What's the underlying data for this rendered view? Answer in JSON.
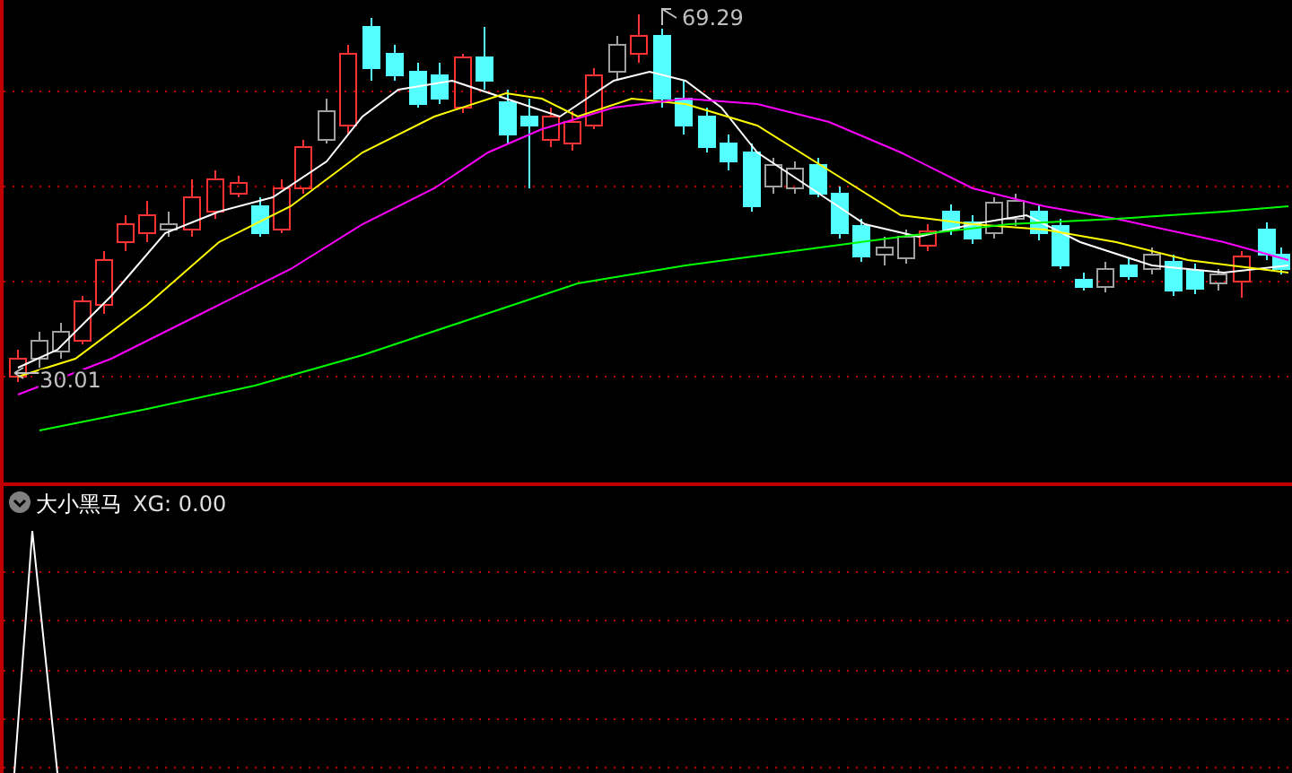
{
  "price_chart": {
    "high_label": "69.29",
    "low_label": "30.01"
  },
  "indicator_pane": {
    "name": "大小黑马",
    "reading": "XG: 0.00"
  }
}
